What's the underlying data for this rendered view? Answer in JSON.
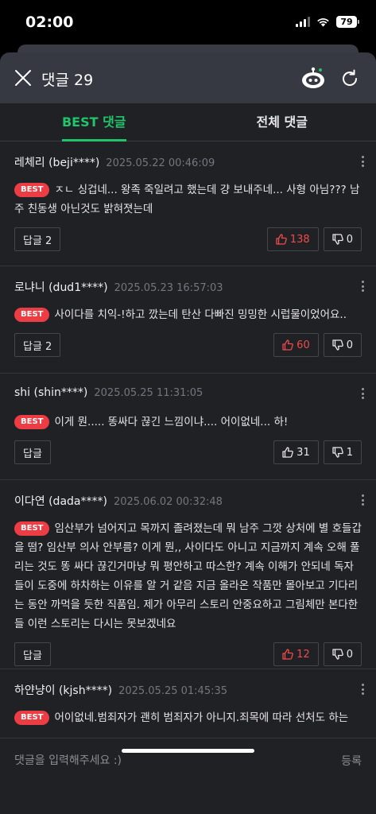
{
  "status": {
    "time": "02:00",
    "battery": "79"
  },
  "header": {
    "title": "댓글 29"
  },
  "tabs": [
    {
      "label": "BEST 댓글",
      "active": true
    },
    {
      "label": "전체 댓글",
      "active": false
    }
  ],
  "best_label": "BEST",
  "comments": [
    {
      "name": "레체리 (beji****)",
      "date": "2025.05.22 00:46:09",
      "text": "ㅈㄴ 싱겁네... 왕족 죽일려고 했는데 걍 보내주네... 사형 아님??? 남주 친동생 아닌것도 밝혀졋는데",
      "reply": "답글 2",
      "likes": "138",
      "dislikes": "0"
    },
    {
      "name": "로냐니 (dud1****)",
      "date": "2025.05.23 16:57:03",
      "text": "사이다를 치익-!하고 깠는데 탄산 다빠진 밍밍한 시럽물이었어요..",
      "reply": "답글 2",
      "likes": "60",
      "dislikes": "0"
    },
    {
      "name": "shi (shin****)",
      "date": "2025.05.25 11:31:05",
      "text": "이게 뭔..... 똥싸다 끊긴 느낌이냐.... 어이없네... 하!",
      "reply": "답글",
      "likes": "31",
      "dislikes": "1"
    },
    {
      "name": "이다연 (dada****)",
      "date": "2025.06.02 00:32:48",
      "text": "임산부가 넘어지고 목까지 졸려졌는데 뭐 남주 그깟 상처에 별 호들갑을 떰? 임산부 의사 안부름? 이게 뭔,, 사이다도 아니고 지금까지 계속 오해 풀리는 것도 똥 싸다 끊긴거마냥 뭐 평안하고 따스한? 계속 이해가 안되네 독자들이 도중에 하차하는 이유를 알 거 같음 지금 올라온 작품만 몰아보고 기다리는 동안 까먹을 듯한 직품임. 제가 아무리 스토리 안중요하고 그림체만 본다한들 이런 스토리는 다시는 못보겠네요",
      "reply": "답글",
      "likes": "12",
      "dislikes": "0"
    },
    {
      "name": "하얀냥이 (kjsh****)",
      "date": "2025.05.25 01:45:35",
      "text": "어이없네.범죄자가 괜히 범죄자가 아니지.죄목에 따라 선처도 하는",
      "reply": "",
      "likes": "",
      "dislikes": ""
    }
  ],
  "input": {
    "placeholder": "댓글을 입력해주세요 :)",
    "submit_label": "등록"
  },
  "colors": {
    "accent": "#21c46a",
    "best_badge": "#ec3c44",
    "like_active": "#ef4b4b"
  }
}
